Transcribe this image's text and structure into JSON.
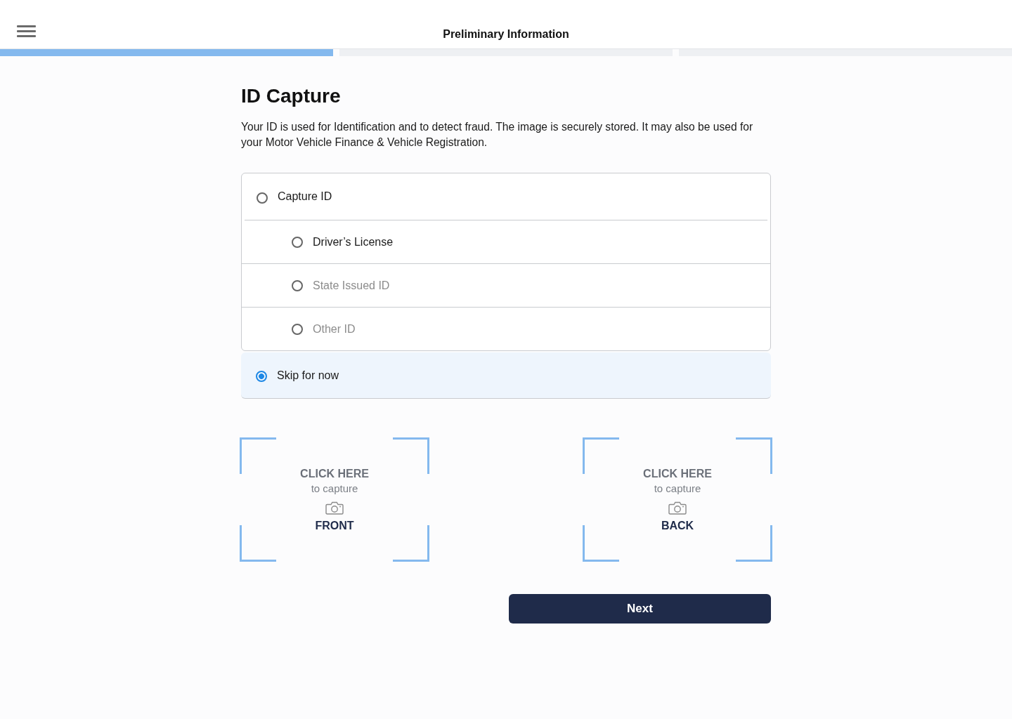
{
  "header": {
    "title": "Preliminary Information"
  },
  "progress": [
    {
      "selected": true
    },
    {
      "selected": false
    },
    {
      "selected": false
    }
  ],
  "heading": "ID Capture",
  "description": "Your ID is used for Identification and to detect fraud. The image is securely stored. It may also be used for your Motor Vehicle Finance & Vehicle Registration.",
  "options": [
    {
      "label": "Capture ID",
      "selected": false,
      "disabled": false,
      "children": [
        {
          "label": "Driver’s License",
          "selected": false,
          "disabled": false
        },
        {
          "label": "State Issued ID",
          "selected": false,
          "disabled": true
        },
        {
          "label": "Other ID",
          "selected": false,
          "disabled": true
        }
      ]
    },
    {
      "label": "Skip for now",
      "selected": true,
      "disabled": false
    }
  ],
  "capture_slots": [
    {
      "prompt": "CLICK HERE",
      "hint": "to capture",
      "label": "FRONT"
    },
    {
      "prompt": "CLICK HERE",
      "hint": "to capture",
      "label": "BACK"
    }
  ],
  "next_button": {
    "label": "Next"
  }
}
